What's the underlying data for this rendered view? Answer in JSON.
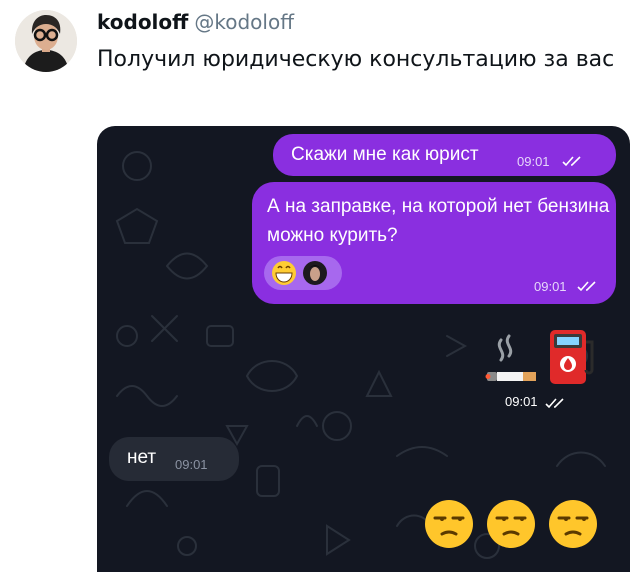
{
  "tweet": {
    "author_name": "kodoloff",
    "author_handle": "@kodoloff",
    "text": "Получил юридическую консультацию за вас"
  },
  "chat": {
    "messages": [
      {
        "direction": "outgoing",
        "text": "Скажи мне как юрист",
        "time": "09:01",
        "status": "read"
      },
      {
        "direction": "outgoing",
        "text": "А на заправке, на которой нет бензина можно курить?",
        "time": "09:01",
        "status": "read",
        "reactions": [
          "grinning-face-emoji",
          "user-avatar"
        ]
      },
      {
        "direction": "outgoing",
        "stickers": [
          "cigarette-emoji",
          "fuel-pump-emoji"
        ],
        "time": "09:01",
        "status": "read"
      },
      {
        "direction": "incoming",
        "text": "нет",
        "time": "09:01"
      },
      {
        "direction": "outgoing",
        "stickers": [
          "unamused-face-emoji",
          "unamused-face-emoji",
          "unamused-face-emoji"
        ]
      }
    ]
  },
  "colors": {
    "outgoing_bubble": "#8a2fe0",
    "incoming_bubble": "#262b36",
    "chat_background": "#131722",
    "handle": "#657786"
  }
}
